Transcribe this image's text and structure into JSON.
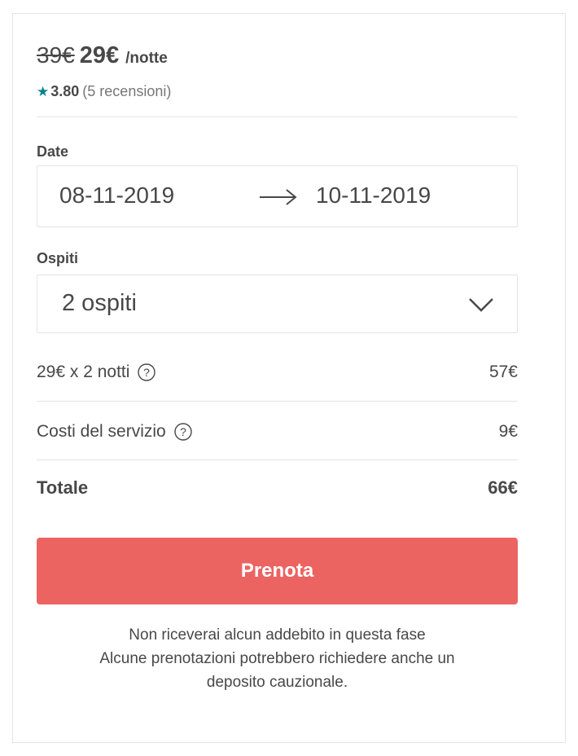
{
  "price": {
    "original": "39€",
    "discounted": "29€",
    "unit": "/notte"
  },
  "rating": {
    "icon": "star-icon",
    "value": "3.80",
    "reviews": "(5 recensioni)",
    "star_color": "#008489"
  },
  "dates": {
    "label": "Date",
    "check_in": "08-11-2019",
    "check_out": "10-11-2019"
  },
  "guests": {
    "label": "Ospiti",
    "selected": "2 ospiti"
  },
  "breakdown": {
    "nights": {
      "label": "29€ x 2 notti",
      "amount": "57€"
    },
    "service": {
      "label": "Costi del servizio",
      "amount": "9€"
    },
    "total": {
      "label": "Totale",
      "amount": "66€"
    }
  },
  "book_button": {
    "label": "Prenota",
    "color": "#eb6462"
  },
  "notice": {
    "line1": "Non riceverai alcun addebito in questa fase",
    "line2": "Alcune prenotazioni potrebbero richiedere anche un",
    "line3": "deposito cauzionale."
  }
}
